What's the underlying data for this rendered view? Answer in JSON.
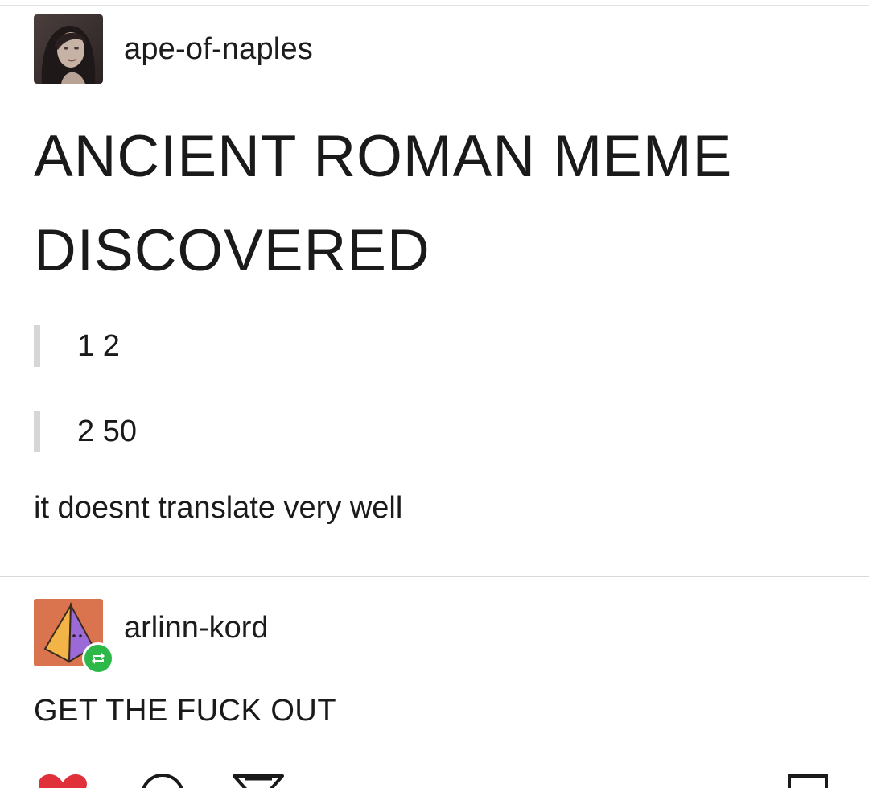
{
  "post": {
    "username": "ape-of-naples",
    "title": "ANCIENT ROMAN MEME DISCOVERED",
    "quotes": [
      "1 2",
      "2 50"
    ],
    "body": "it doesnt translate very well"
  },
  "reply": {
    "username": "arlinn-kord",
    "body": "GET THE FUCK OUT"
  },
  "actions": {
    "icons": [
      "heart-icon",
      "comment-icon",
      "share-icon",
      "bookmark-icon"
    ]
  },
  "colors": {
    "like": "#e0303a",
    "reblog_badge": "#2db84a",
    "avatar2_bg": "#d9744e"
  }
}
